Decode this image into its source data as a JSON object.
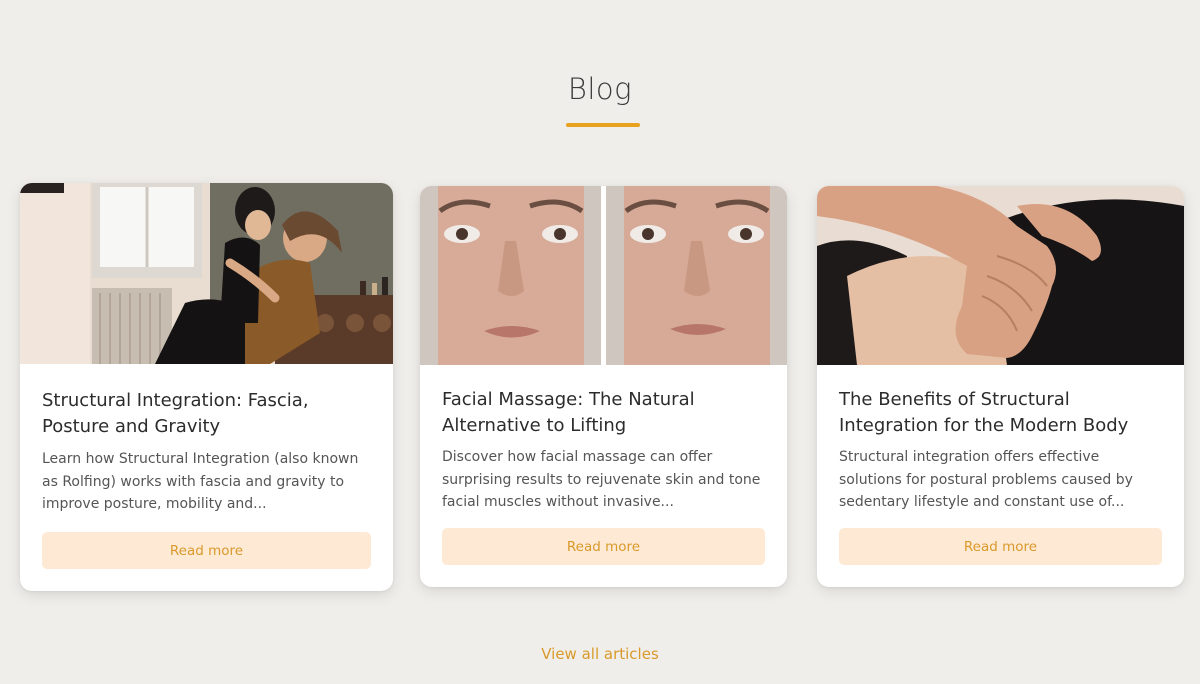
{
  "section": {
    "title": "Blog"
  },
  "colors": {
    "accent": "#e8a21e",
    "button_bg": "#fde9d4",
    "button_text": "#d99a2b",
    "page_bg": "#f0eeea"
  },
  "posts": [
    {
      "title": "Structural Integration: Fascia, Posture and Gravity",
      "excerpt": "Learn how Structural Integration (also known as Rolfing) works with fascia and gravity to improve posture, mobility and...",
      "button_label": "Read more",
      "image_icon": "photo-bodywork-session"
    },
    {
      "title": "Facial Massage: The Natural Alternative to Lifting",
      "excerpt": "Discover how facial massage can offer surprising results to rejuvenate skin and tone facial muscles without invasive...",
      "button_label": "Read more",
      "image_icon": "photo-face-before-after"
    },
    {
      "title": "The Benefits of Structural Integration for the Modern Body",
      "excerpt": "Structural integration offers effective solutions for postural problems caused by sedentary lifestyle and constant use of...",
      "button_label": "Read more",
      "image_icon": "photo-hand-massage"
    }
  ],
  "footer": {
    "view_all_label": "View all articles"
  }
}
